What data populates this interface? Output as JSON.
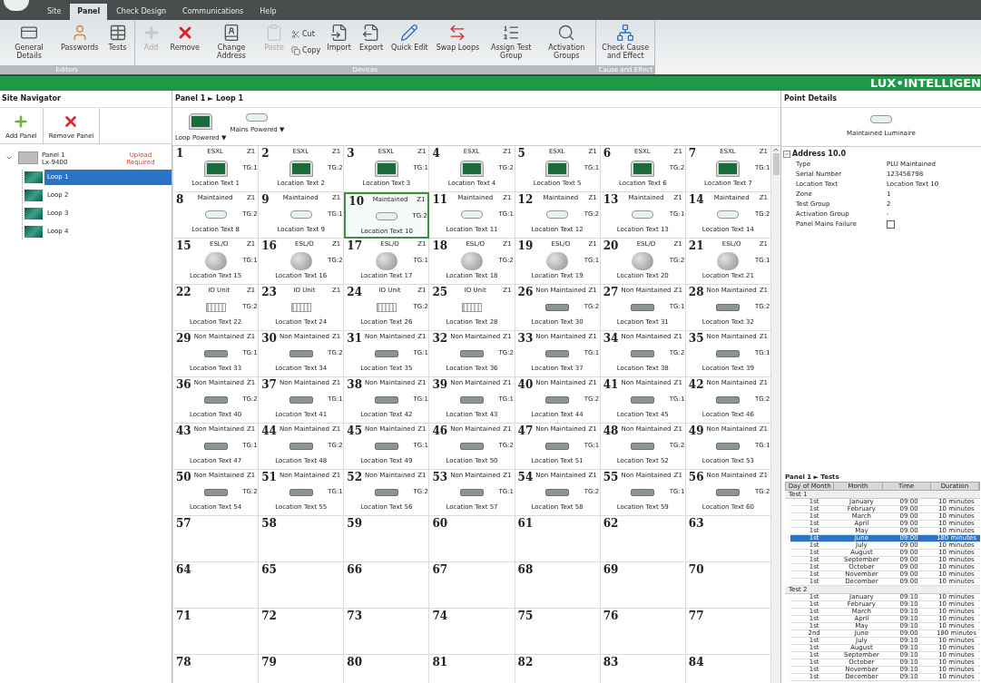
{
  "menu_tabs": [
    {
      "label": "Site",
      "selected": false
    },
    {
      "label": "Panel",
      "selected": true
    },
    {
      "label": "Check Design",
      "selected": false
    },
    {
      "label": "Communications",
      "selected": false
    },
    {
      "label": "Help",
      "selected": false
    }
  ],
  "ribbon_groups": [
    {
      "label": "Editors",
      "buttons": [
        {
          "label": "General Details",
          "kind": "large",
          "disabled": false
        },
        {
          "label": "Passwords",
          "kind": "large",
          "disabled": false
        },
        {
          "label": "Tests",
          "kind": "large",
          "disabled": false
        }
      ]
    },
    {
      "label": "Devices",
      "buttons": [
        {
          "label": "Add",
          "kind": "large",
          "disabled": true
        },
        {
          "label": "Remove",
          "kind": "large",
          "disabled": false
        },
        {
          "label": "Change Address",
          "kind": "large",
          "disabled": false
        },
        {
          "label": "Paste",
          "kind": "large",
          "disabled": true
        },
        {
          "label": "Cut",
          "kind": "small",
          "disabled": false
        },
        {
          "label": "Copy",
          "kind": "small",
          "disabled": false
        },
        {
          "label": "Import",
          "kind": "large",
          "disabled": false
        },
        {
          "label": "Export",
          "kind": "large",
          "disabled": false
        },
        {
          "label": "Quick Edit",
          "kind": "large",
          "disabled": false
        },
        {
          "label": "Swap Loops",
          "kind": "large",
          "disabled": false
        },
        {
          "label": "Assign Test Group",
          "kind": "large",
          "disabled": false
        },
        {
          "label": "Activation Groups",
          "kind": "large",
          "disabled": false
        }
      ]
    },
    {
      "label": "Cause and Effect",
      "buttons": [
        {
          "label": "Check Cause and Effect",
          "kind": "large",
          "disabled": false
        }
      ]
    }
  ],
  "brand": "LUX•INTELLIGEN",
  "site_navigator": {
    "title": "Site Navigator",
    "actions": [
      {
        "label": "Add Panel"
      },
      {
        "label": "Remove Panel"
      }
    ],
    "tree": [
      {
        "label": "Panel 1",
        "sublabel": "Lx-9400",
        "status": "Upload Required",
        "expanded": true,
        "selected": false,
        "children": [
          {
            "label": "Loop 1",
            "selected": true
          },
          {
            "label": "Loop 2",
            "selected": false
          },
          {
            "label": "Loop 3",
            "selected": false
          },
          {
            "label": "Loop 4",
            "selected": false
          }
        ]
      }
    ]
  },
  "loop_view": {
    "breadcrumb": "Panel 1 ► Loop 1",
    "palette": [
      {
        "label": "Loop Powered ▼",
        "kind": "esxl"
      },
      {
        "label": "Mains Powered ▼",
        "kind": "maintained"
      }
    ],
    "cells": [
      {
        "number": "1",
        "type": "ESXL",
        "zone": "Z1",
        "kind": "esxl",
        "tg": "TG:1",
        "location": "Location Text 1",
        "selected": false
      },
      {
        "number": "2",
        "type": "ESXL",
        "zone": "Z1",
        "kind": "esxl",
        "tg": "TG:2",
        "location": "Location Text 2",
        "selected": false
      },
      {
        "number": "3",
        "type": "ESXL",
        "zone": "Z1",
        "kind": "esxl",
        "tg": "TG:1",
        "location": "Location Text 3",
        "selected": false
      },
      {
        "number": "4",
        "type": "ESXL",
        "zone": "Z1",
        "kind": "esxl",
        "tg": "TG:2",
        "location": "Location Text 4",
        "selected": false
      },
      {
        "number": "5",
        "type": "ESXL",
        "zone": "Z1",
        "kind": "esxl",
        "tg": "TG:1",
        "location": "Location Text 5",
        "selected": false
      },
      {
        "number": "6",
        "type": "ESXL",
        "zone": "Z1",
        "kind": "esxl",
        "tg": "TG:2",
        "location": "Location Text 6",
        "selected": false
      },
      {
        "number": "7",
        "type": "ESXL",
        "zone": "Z1",
        "kind": "esxl",
        "tg": "TG:1",
        "location": "Location Text 7",
        "selected": false
      },
      {
        "number": "8",
        "type": "Maintained",
        "zone": "Z1",
        "kind": "maintained",
        "tg": "TG:2",
        "location": "Location Text 8",
        "selected": false
      },
      {
        "number": "9",
        "type": "Maintained",
        "zone": "Z1",
        "kind": "maintained",
        "tg": "TG:1",
        "location": "Location Text 9",
        "selected": false
      },
      {
        "number": "10",
        "type": "Maintained",
        "zone": "Z1",
        "kind": "maintained",
        "tg": "TG:2",
        "location": "Location Text 10",
        "selected": true
      },
      {
        "number": "11",
        "type": "Maintained",
        "zone": "Z1",
        "kind": "maintained",
        "tg": "TG:1",
        "location": "Location Text 11",
        "selected": false
      },
      {
        "number": "12",
        "type": "Maintained",
        "zone": "Z1",
        "kind": "maintained",
        "tg": "TG:2",
        "location": "Location Text 12",
        "selected": false
      },
      {
        "number": "13",
        "type": "Maintained",
        "zone": "Z1",
        "kind": "maintained",
        "tg": "TG:1",
        "location": "Location Text 13",
        "selected": false
      },
      {
        "number": "14",
        "type": "Maintained",
        "zone": "Z1",
        "kind": "maintained",
        "tg": "TG:2",
        "location": "Location Text 14",
        "selected": false
      },
      {
        "number": "15",
        "type": "ESL/O",
        "zone": "Z1",
        "kind": "eslo",
        "tg": "TG:1",
        "location": "Location Text 15",
        "selected": false
      },
      {
        "number": "16",
        "type": "ESL/O",
        "zone": "Z1",
        "kind": "eslo",
        "tg": "TG:2",
        "location": "Location Text 16",
        "selected": false
      },
      {
        "number": "17",
        "type": "ESL/O",
        "zone": "Z1",
        "kind": "eslo",
        "tg": "TG:1",
        "location": "Location Text 17",
        "selected": false
      },
      {
        "number": "18",
        "type": "ESL/O",
        "zone": "Z1",
        "kind": "eslo",
        "tg": "TG:2",
        "location": "Location Text 18",
        "selected": false
      },
      {
        "number": "19",
        "type": "ESL/O",
        "zone": "Z1",
        "kind": "eslo",
        "tg": "TG:1",
        "location": "Location Text 19",
        "selected": false
      },
      {
        "number": "20",
        "type": "ESL/O",
        "zone": "Z1",
        "kind": "eslo",
        "tg": "TG:2",
        "location": "Location Text 20",
        "selected": false
      },
      {
        "number": "21",
        "type": "ESL/O",
        "zone": "Z1",
        "kind": "eslo",
        "tg": "TG:1",
        "location": "Location Text 21",
        "selected": false
      },
      {
        "number": "22",
        "type": "IO Unit",
        "zone": "Z1",
        "kind": "io",
        "tg": "TG:2",
        "location": "Location Text 22",
        "selected": false
      },
      {
        "number": "23",
        "type": "IO Unit",
        "zone": "Z1",
        "kind": "io",
        "location": "Location Text 24",
        "selected": false
      },
      {
        "number": "24",
        "type": "IO Unit",
        "zone": "Z1",
        "kind": "io",
        "tg": "TG:2",
        "location": "Location Text 26",
        "selected": false
      },
      {
        "number": "25",
        "type": "IO Unit",
        "zone": "Z1",
        "kind": "io",
        "location": "Location Text 28",
        "selected": false
      },
      {
        "number": "26",
        "type": "Non Maintained",
        "zone": "Z1",
        "kind": "nonmaintained",
        "tg": "TG:2",
        "location": "Location Text 30",
        "selected": false
      },
      {
        "number": "27",
        "type": "Non Maintained",
        "zone": "Z1",
        "kind": "nonmaintained",
        "tg": "TG:1",
        "location": "Location Text 31",
        "selected": false
      },
      {
        "number": "28",
        "type": "Non Maintained",
        "zone": "Z1",
        "kind": "nonmaintained",
        "tg": "TG:2",
        "location": "Location Text 32",
        "selected": false
      },
      {
        "number": "29",
        "type": "Non Maintained",
        "zone": "Z1",
        "kind": "nonmaintained",
        "tg": "TG:1",
        "location": "Location Text 33",
        "selected": false
      },
      {
        "number": "30",
        "type": "Non Maintained",
        "zone": "Z1",
        "kind": "nonmaintained",
        "tg": "TG:2",
        "location": "Location Text 34",
        "selected": false
      },
      {
        "number": "31",
        "type": "Non Maintained",
        "zone": "Z1",
        "kind": "nonmaintained",
        "tg": "TG:1",
        "location": "Location Text 35",
        "selected": false
      },
      {
        "number": "32",
        "type": "Non Maintained",
        "zone": "Z1",
        "kind": "nonmaintained",
        "tg": "TG:2",
        "location": "Location Text 36",
        "selected": false
      },
      {
        "number": "33",
        "type": "Non Maintained",
        "zone": "Z1",
        "kind": "nonmaintained",
        "tg": "TG:1",
        "location": "Location Text 37",
        "selected": false
      },
      {
        "number": "34",
        "type": "Non Maintained",
        "zone": "Z1",
        "kind": "nonmaintained",
        "tg": "TG:2",
        "location": "Location Text 38",
        "selected": false
      },
      {
        "number": "35",
        "type": "Non Maintained",
        "zone": "Z1",
        "kind": "nonmaintained",
        "tg": "TG:1",
        "location": "Location Text 39",
        "selected": false
      },
      {
        "number": "36",
        "type": "Non Maintained",
        "zone": "Z1",
        "kind": "nonmaintained",
        "tg": "TG:2",
        "location": "Location Text 40",
        "selected": false
      },
      {
        "number": "37",
        "type": "Non Maintained",
        "zone": "Z1",
        "kind": "nonmaintained",
        "tg": "TG:1",
        "location": "Location Text 41",
        "selected": false
      },
      {
        "number": "38",
        "type": "Non Maintained",
        "zone": "Z1",
        "kind": "nonmaintained",
        "tg": "TG:1",
        "location": "Location Text 42",
        "selected": false
      },
      {
        "number": "39",
        "type": "Non Maintained",
        "zone": "Z1",
        "kind": "nonmaintained",
        "tg": "TG:1",
        "location": "Location Text 43",
        "selected": false
      },
      {
        "number": "40",
        "type": "Non Maintained",
        "zone": "Z1",
        "kind": "nonmaintained",
        "tg": "TG:2",
        "location": "Location Text 44",
        "selected": false
      },
      {
        "number": "41",
        "type": "Non Maintained",
        "zone": "Z1",
        "kind": "nonmaintained",
        "tg": "TG:1",
        "location": "Location Text 45",
        "selected": false
      },
      {
        "number": "42",
        "type": "Non Maintained",
        "zone": "Z1",
        "kind": "nonmaintained",
        "tg": "TG:2",
        "location": "Location Text 46",
        "selected": false
      },
      {
        "number": "43",
        "type": "Non Maintained",
        "zone": "Z1",
        "kind": "nonmaintained",
        "tg": "TG:1",
        "location": "Location Text 47",
        "selected": false
      },
      {
        "number": "44",
        "type": "Non Maintained",
        "zone": "Z1",
        "kind": "nonmaintained",
        "tg": "TG:2",
        "location": "Location Text 48",
        "selected": false
      },
      {
        "number": "45",
        "type": "Non Maintained",
        "zone": "Z1",
        "kind": "nonmaintained",
        "tg": "TG:1",
        "location": "Location Text 49",
        "selected": false
      },
      {
        "number": "46",
        "type": "Non Maintained",
        "zone": "Z1",
        "kind": "nonmaintained",
        "tg": "TG:2",
        "location": "Location Text 50",
        "selected": false
      },
      {
        "number": "47",
        "type": "Non Maintained",
        "zone": "Z1",
        "kind": "nonmaintained",
        "tg": "TG:1",
        "location": "Location Text 51",
        "selected": false
      },
      {
        "number": "48",
        "type": "Non Maintained",
        "zone": "Z1",
        "kind": "nonmaintained",
        "tg": "TG:2",
        "location": "Location Text 52",
        "selected": false
      },
      {
        "number": "49",
        "type": "Non Maintained",
        "zone": "Z1",
        "kind": "nonmaintained",
        "tg": "TG:1",
        "location": "Location Text 53",
        "selected": false
      },
      {
        "number": "50",
        "type": "Non Maintained",
        "zone": "Z1",
        "kind": "nonmaintained",
        "tg": "TG:2",
        "location": "Location Text 54",
        "selected": false
      },
      {
        "number": "51",
        "type": "Non Maintained",
        "zone": "Z1",
        "kind": "nonmaintained",
        "tg": "TG:1",
        "location": "Location Text 55",
        "selected": false
      },
      {
        "number": "52",
        "type": "Non Maintained",
        "zone": "Z1",
        "kind": "nonmaintained",
        "tg": "TG:2",
        "location": "Location Text 56",
        "selected": false
      },
      {
        "number": "53",
        "type": "Non Maintained",
        "zone": "Z1",
        "kind": "nonmaintained",
        "tg": "TG:1",
        "location": "Location Text 57",
        "selected": false
      },
      {
        "number": "54",
        "type": "Non Maintained",
        "zone": "Z1",
        "kind": "nonmaintained",
        "tg": "TG:2",
        "location": "Location Text 58",
        "selected": false
      },
      {
        "number": "55",
        "type": "Non Maintained",
        "zone": "Z1",
        "kind": "nonmaintained",
        "tg": "TG:1",
        "location": "Location Text 59",
        "selected": false
      },
      {
        "number": "56",
        "type": "Non Maintained",
        "zone": "Z1",
        "kind": "nonmaintained",
        "tg": "TG:2",
        "location": "Location Text 60",
        "selected": false
      },
      {
        "number": "57"
      },
      {
        "number": "58"
      },
      {
        "number": "59"
      },
      {
        "number": "60"
      },
      {
        "number": "61"
      },
      {
        "number": "62"
      },
      {
        "number": "63"
      },
      {
        "number": "64"
      },
      {
        "number": "65"
      },
      {
        "number": "66"
      },
      {
        "number": "67"
      },
      {
        "number": "68"
      },
      {
        "number": "69"
      },
      {
        "number": "70"
      },
      {
        "number": "71"
      },
      {
        "number": "72"
      },
      {
        "number": "73"
      },
      {
        "number": "74"
      },
      {
        "number": "75"
      },
      {
        "number": "76"
      },
      {
        "number": "77"
      },
      {
        "number": "78"
      },
      {
        "number": "79"
      },
      {
        "number": "80"
      },
      {
        "number": "81"
      },
      {
        "number": "82"
      },
      {
        "number": "83"
      },
      {
        "number": "84"
      }
    ]
  },
  "point_details": {
    "title": "Point Details",
    "device_label": "Maintained Luminaire",
    "section": "Address 10.0",
    "expanded": true,
    "properties": [
      {
        "name": "Type",
        "value": "PLU Maintained"
      },
      {
        "name": "Serial Number",
        "value": "123456798"
      },
      {
        "name": "Location Text",
        "value": "Location Text 10"
      },
      {
        "name": "Zone",
        "value": "1"
      },
      {
        "name": "Test Group",
        "value": "2"
      },
      {
        "name": "Activation Group",
        "value": "-"
      },
      {
        "name": "Panel Mains Failure",
        "kind": "checkbox",
        "checked": false
      }
    ]
  },
  "tests_preview": {
    "title": "Panel 1 ► Tests",
    "columns": [
      "Day of Month",
      "Month",
      "Time",
      "Duration"
    ],
    "groups": [
      {
        "label": "Test 1",
        "rows": [
          {
            "cells": [
              "1st",
              "January",
              "09:00",
              "10 minutes"
            ],
            "selected": false
          },
          {
            "cells": [
              "1st",
              "February",
              "09:00",
              "10 minutes"
            ],
            "selected": false
          },
          {
            "cells": [
              "1st",
              "March",
              "09:00",
              "10 minutes"
            ],
            "selected": false
          },
          {
            "cells": [
              "1st",
              "April",
              "09:00",
              "10 minutes"
            ],
            "selected": false
          },
          {
            "cells": [
              "1st",
              "May",
              "09:00",
              "10 minutes"
            ],
            "selected": false
          },
          {
            "cells": [
              "1st",
              "June",
              "09:00",
              "180 minutes"
            ],
            "selected": true
          },
          {
            "cells": [
              "1st",
              "July",
              "09:00",
              "10 minutes"
            ],
            "selected": false
          },
          {
            "cells": [
              "1st",
              "August",
              "09:00",
              "10 minutes"
            ],
            "selected": false
          },
          {
            "cells": [
              "1st",
              "September",
              "09:00",
              "10 minutes"
            ],
            "selected": false
          },
          {
            "cells": [
              "1st",
              "October",
              "09:00",
              "10 minutes"
            ],
            "selected": false
          },
          {
            "cells": [
              "1st",
              "November",
              "09:00",
              "10 minutes"
            ],
            "selected": false
          },
          {
            "cells": [
              "1st",
              "December",
              "09:00",
              "10 minutes"
            ],
            "selected": false
          }
        ]
      },
      {
        "label": "Test 2",
        "rows": [
          {
            "cells": [
              "1st",
              "January",
              "09:10",
              "10 minutes"
            ],
            "selected": false
          },
          {
            "cells": [
              "1st",
              "February",
              "09:10",
              "10 minutes"
            ],
            "selected": false
          },
          {
            "cells": [
              "1st",
              "March",
              "09:10",
              "10 minutes"
            ],
            "selected": false
          },
          {
            "cells": [
              "1st",
              "April",
              "09:10",
              "10 minutes"
            ],
            "selected": false
          },
          {
            "cells": [
              "1st",
              "May",
              "09:10",
              "10 minutes"
            ],
            "selected": false
          },
          {
            "cells": [
              "2nd",
              "June",
              "09:00",
              "180 minutes"
            ],
            "selected": false
          },
          {
            "cells": [
              "1st",
              "July",
              "09:10",
              "10 minutes"
            ],
            "selected": false
          },
          {
            "cells": [
              "1st",
              "August",
              "09:10",
              "10 minutes"
            ],
            "selected": false
          },
          {
            "cells": [
              "1st",
              "September",
              "09:10",
              "10 minutes"
            ],
            "selected": false
          },
          {
            "cells": [
              "1st",
              "October",
              "09:10",
              "10 minutes"
            ],
            "selected": false
          },
          {
            "cells": [
              "1st",
              "November",
              "09:10",
              "10 minutes"
            ],
            "selected": false
          },
          {
            "cells": [
              "1st",
              "December",
              "09:10",
              "10 minutes"
            ],
            "selected": false
          }
        ]
      }
    ]
  }
}
